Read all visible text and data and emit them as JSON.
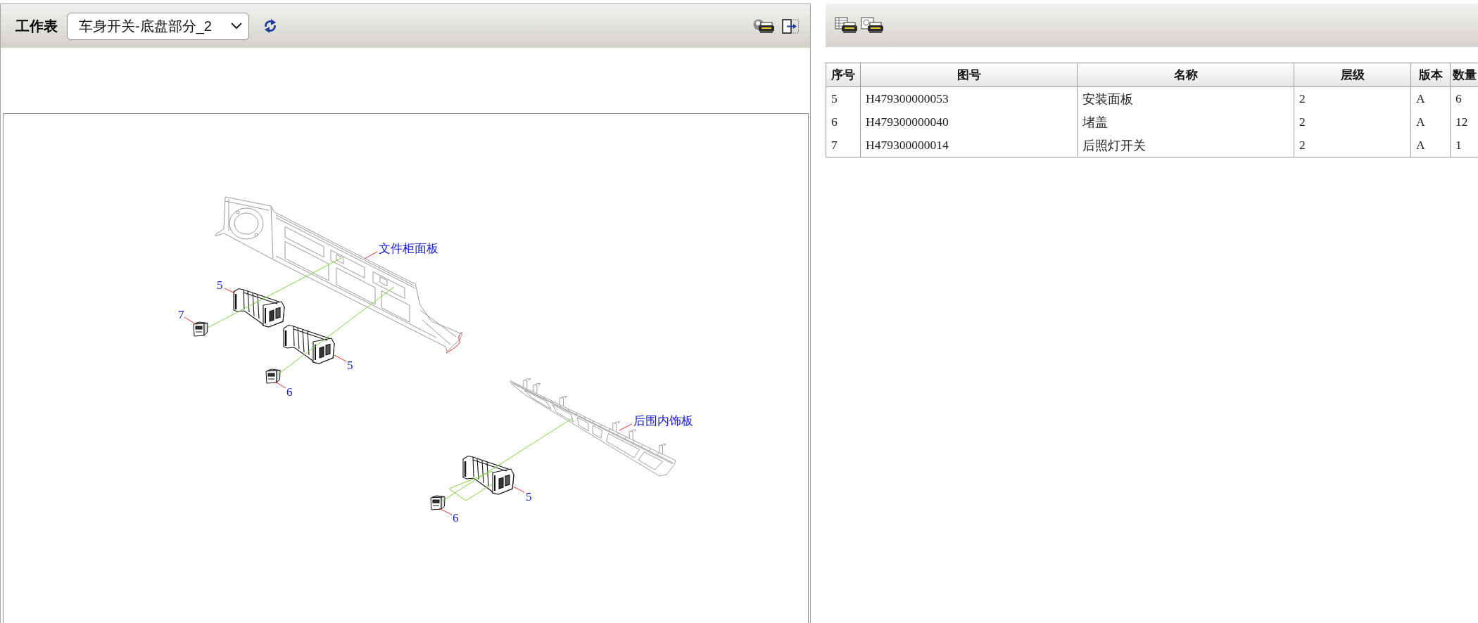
{
  "worksheet": {
    "label": "工作表",
    "sheet_select": {
      "value": "车身开关-底盘部分_2"
    }
  },
  "diagram": {
    "assemblies": [
      {
        "kind": "cabinet",
        "label": "文件柜面板",
        "callouts": [
          {
            "number": "5",
            "kind": "bracket"
          },
          {
            "number": "7",
            "kind": "switch"
          },
          {
            "number": "5",
            "kind": "bracket"
          },
          {
            "number": "6",
            "kind": "switch"
          }
        ]
      },
      {
        "kind": "trim",
        "label": "后围内饰板",
        "callouts": [
          {
            "number": "5",
            "kind": "bracket"
          },
          {
            "number": "6",
            "kind": "switch"
          }
        ]
      }
    ]
  },
  "parts_table": {
    "columns": [
      "序号",
      "图号",
      "名称",
      "层级",
      "版本",
      "数量"
    ],
    "rows": [
      [
        "5",
        "H479300000053",
        "安装面板",
        "2",
        "A",
        "6"
      ],
      [
        "6",
        "H479300000040",
        "堵盖",
        "2",
        "A",
        "12"
      ],
      [
        "7",
        "H479300000014",
        "后照灯开关",
        "2",
        "A",
        "1"
      ]
    ]
  }
}
